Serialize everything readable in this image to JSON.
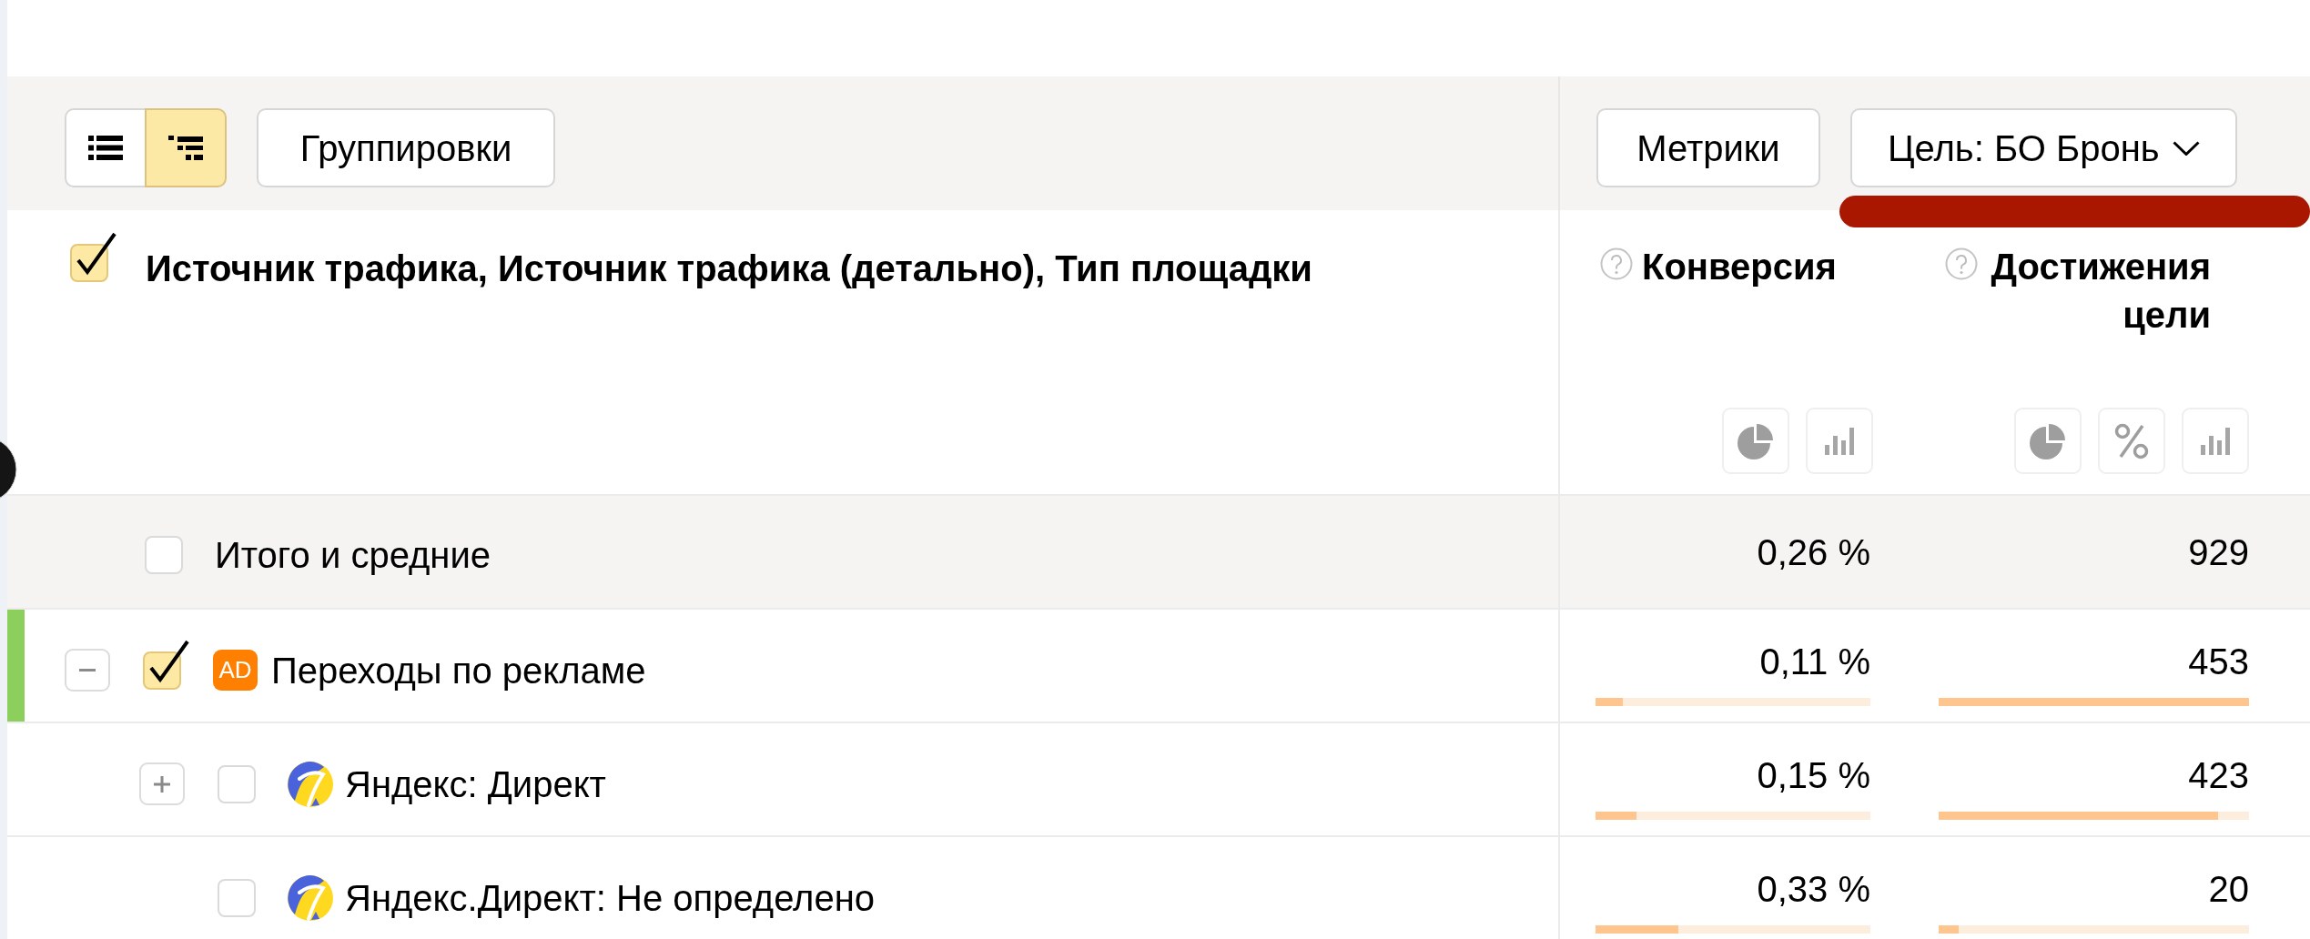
{
  "toolbar": {
    "view_modes": [
      {
        "kind": "list",
        "selected": false
      },
      {
        "kind": "tree",
        "selected": true
      }
    ],
    "groupings_button": "Группировки",
    "metrics_button": "Метрики",
    "goal_select": {
      "value": "Цель: БО Бронь"
    }
  },
  "table": {
    "dimension_header": {
      "label": "Источник трафика, Источник трафика (детально), Тип площадки",
      "checked": true
    },
    "columns": [
      {
        "title": "Конверсия",
        "tools": [
          {
            "kind": "pie"
          },
          {
            "kind": "bars"
          }
        ]
      },
      {
        "title": "Достижения цели",
        "tools": [
          {
            "kind": "pie"
          },
          {
            "kind": "percent"
          },
          {
            "kind": "bars"
          }
        ]
      }
    ],
    "totals": {
      "label": "Итого и средние",
      "checked": false,
      "values": [
        "0,26 %",
        "929"
      ]
    },
    "rows": [
      {
        "label": "Переходы по рекламе",
        "kind": "ad",
        "badge": "AD",
        "checked": true,
        "expanded": true,
        "color": "#8dcf5c",
        "values": [
          {
            "text": "0,11 %",
            "level": 0.1
          },
          {
            "text": "453",
            "level": 1
          }
        ],
        "children": [
          {
            "label": "Яндекс: Директ",
            "kind": "direct",
            "checked": false,
            "expanded": false,
            "values": [
              {
                "text": "0,15 %",
                "level": 0.15
              },
              {
                "text": "423",
                "level": 0.9
              }
            ]
          },
          {
            "label": "Яндекс.Директ: Не определено",
            "kind": "direct",
            "checked": false,
            "values": [
              {
                "text": "0,33 %",
                "level": 0.3
              },
              {
                "text": "20",
                "level": 0.065
              }
            ]
          }
        ]
      }
    ]
  }
}
